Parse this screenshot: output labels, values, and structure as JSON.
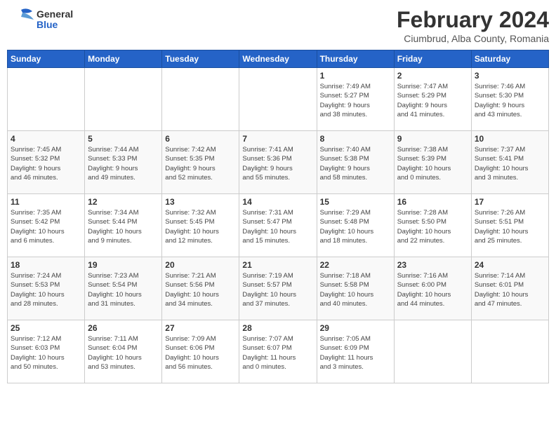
{
  "header": {
    "logo_general": "General",
    "logo_blue": "Blue",
    "title": "February 2024",
    "subtitle": "Ciumbrud, Alba County, Romania"
  },
  "days_of_week": [
    "Sunday",
    "Monday",
    "Tuesday",
    "Wednesday",
    "Thursday",
    "Friday",
    "Saturday"
  ],
  "weeks": [
    [
      {
        "day": "",
        "info": ""
      },
      {
        "day": "",
        "info": ""
      },
      {
        "day": "",
        "info": ""
      },
      {
        "day": "",
        "info": ""
      },
      {
        "day": "1",
        "info": "Sunrise: 7:49 AM\nSunset: 5:27 PM\nDaylight: 9 hours\nand 38 minutes."
      },
      {
        "day": "2",
        "info": "Sunrise: 7:47 AM\nSunset: 5:29 PM\nDaylight: 9 hours\nand 41 minutes."
      },
      {
        "day": "3",
        "info": "Sunrise: 7:46 AM\nSunset: 5:30 PM\nDaylight: 9 hours\nand 43 minutes."
      }
    ],
    [
      {
        "day": "4",
        "info": "Sunrise: 7:45 AM\nSunset: 5:32 PM\nDaylight: 9 hours\nand 46 minutes."
      },
      {
        "day": "5",
        "info": "Sunrise: 7:44 AM\nSunset: 5:33 PM\nDaylight: 9 hours\nand 49 minutes."
      },
      {
        "day": "6",
        "info": "Sunrise: 7:42 AM\nSunset: 5:35 PM\nDaylight: 9 hours\nand 52 minutes."
      },
      {
        "day": "7",
        "info": "Sunrise: 7:41 AM\nSunset: 5:36 PM\nDaylight: 9 hours\nand 55 minutes."
      },
      {
        "day": "8",
        "info": "Sunrise: 7:40 AM\nSunset: 5:38 PM\nDaylight: 9 hours\nand 58 minutes."
      },
      {
        "day": "9",
        "info": "Sunrise: 7:38 AM\nSunset: 5:39 PM\nDaylight: 10 hours\nand 0 minutes."
      },
      {
        "day": "10",
        "info": "Sunrise: 7:37 AM\nSunset: 5:41 PM\nDaylight: 10 hours\nand 3 minutes."
      }
    ],
    [
      {
        "day": "11",
        "info": "Sunrise: 7:35 AM\nSunset: 5:42 PM\nDaylight: 10 hours\nand 6 minutes."
      },
      {
        "day": "12",
        "info": "Sunrise: 7:34 AM\nSunset: 5:44 PM\nDaylight: 10 hours\nand 9 minutes."
      },
      {
        "day": "13",
        "info": "Sunrise: 7:32 AM\nSunset: 5:45 PM\nDaylight: 10 hours\nand 12 minutes."
      },
      {
        "day": "14",
        "info": "Sunrise: 7:31 AM\nSunset: 5:47 PM\nDaylight: 10 hours\nand 15 minutes."
      },
      {
        "day": "15",
        "info": "Sunrise: 7:29 AM\nSunset: 5:48 PM\nDaylight: 10 hours\nand 18 minutes."
      },
      {
        "day": "16",
        "info": "Sunrise: 7:28 AM\nSunset: 5:50 PM\nDaylight: 10 hours\nand 22 minutes."
      },
      {
        "day": "17",
        "info": "Sunrise: 7:26 AM\nSunset: 5:51 PM\nDaylight: 10 hours\nand 25 minutes."
      }
    ],
    [
      {
        "day": "18",
        "info": "Sunrise: 7:24 AM\nSunset: 5:53 PM\nDaylight: 10 hours\nand 28 minutes."
      },
      {
        "day": "19",
        "info": "Sunrise: 7:23 AM\nSunset: 5:54 PM\nDaylight: 10 hours\nand 31 minutes."
      },
      {
        "day": "20",
        "info": "Sunrise: 7:21 AM\nSunset: 5:56 PM\nDaylight: 10 hours\nand 34 minutes."
      },
      {
        "day": "21",
        "info": "Sunrise: 7:19 AM\nSunset: 5:57 PM\nDaylight: 10 hours\nand 37 minutes."
      },
      {
        "day": "22",
        "info": "Sunrise: 7:18 AM\nSunset: 5:58 PM\nDaylight: 10 hours\nand 40 minutes."
      },
      {
        "day": "23",
        "info": "Sunrise: 7:16 AM\nSunset: 6:00 PM\nDaylight: 10 hours\nand 44 minutes."
      },
      {
        "day": "24",
        "info": "Sunrise: 7:14 AM\nSunset: 6:01 PM\nDaylight: 10 hours\nand 47 minutes."
      }
    ],
    [
      {
        "day": "25",
        "info": "Sunrise: 7:12 AM\nSunset: 6:03 PM\nDaylight: 10 hours\nand 50 minutes."
      },
      {
        "day": "26",
        "info": "Sunrise: 7:11 AM\nSunset: 6:04 PM\nDaylight: 10 hours\nand 53 minutes."
      },
      {
        "day": "27",
        "info": "Sunrise: 7:09 AM\nSunset: 6:06 PM\nDaylight: 10 hours\nand 56 minutes."
      },
      {
        "day": "28",
        "info": "Sunrise: 7:07 AM\nSunset: 6:07 PM\nDaylight: 11 hours\nand 0 minutes."
      },
      {
        "day": "29",
        "info": "Sunrise: 7:05 AM\nSunset: 6:09 PM\nDaylight: 11 hours\nand 3 minutes."
      },
      {
        "day": "",
        "info": ""
      },
      {
        "day": "",
        "info": ""
      }
    ]
  ]
}
